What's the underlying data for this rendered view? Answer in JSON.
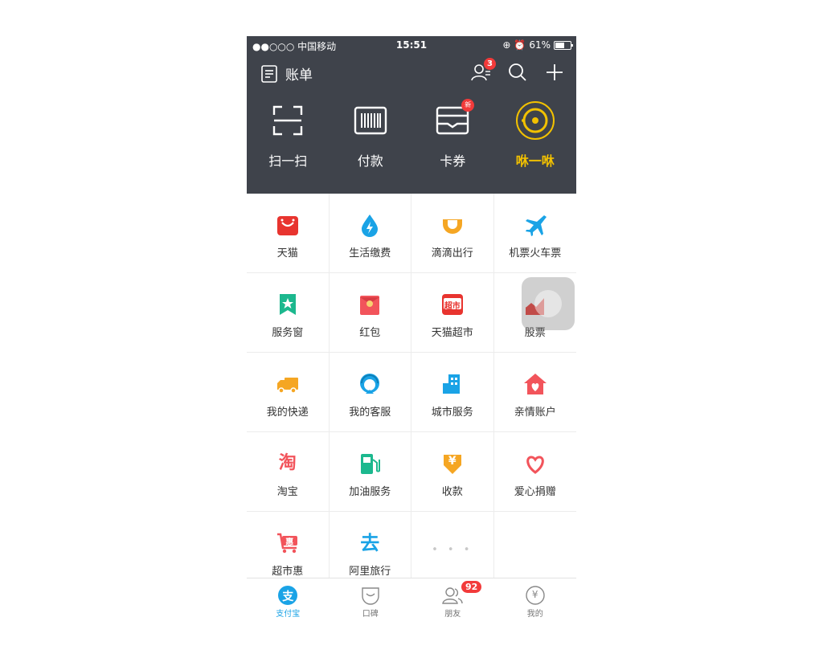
{
  "status_bar": {
    "carrier": "●●○○○ 中国移动",
    "time": "15:51",
    "battery": "61%"
  },
  "header": {
    "bill_label": "账单",
    "contacts_badge": "3"
  },
  "quick_actions": [
    {
      "label": "扫一扫",
      "icon": "scan-icon"
    },
    {
      "label": "付款",
      "icon": "barcode-icon"
    },
    {
      "label": "卡券",
      "icon": "card-voucher-icon",
      "badge": "新"
    },
    {
      "label": "咻一咻",
      "icon": "xiu-icon"
    }
  ],
  "grid": [
    {
      "label": "天猫",
      "icon": "tmall-icon",
      "color": "#e8342f"
    },
    {
      "label": "生活缴费",
      "icon": "water-drop-icon",
      "color": "#1aa3e6"
    },
    {
      "label": "滴滴出行",
      "icon": "didi-icon",
      "color": "#f5a623"
    },
    {
      "label": "机票火车票",
      "icon": "airplane-icon",
      "color": "#1aa3e6"
    },
    {
      "label": "服务窗",
      "icon": "star-bookmark-icon",
      "color": "#1cb88e"
    },
    {
      "label": "红包",
      "icon": "red-envelope-icon",
      "color": "#f2545b"
    },
    {
      "label": "天猫超市",
      "icon": "supermarket-icon",
      "color": "#e8342f",
      "icon_text": "超市"
    },
    {
      "label": "股票",
      "icon": "stock-chart-icon",
      "color": "#e8342f"
    },
    {
      "label": "我的快递",
      "icon": "delivery-truck-icon",
      "color": "#f5a623"
    },
    {
      "label": "我的客服",
      "icon": "customer-service-icon",
      "color": "#1aa3e6"
    },
    {
      "label": "城市服务",
      "icon": "city-building-icon",
      "color": "#1aa3e6"
    },
    {
      "label": "亲情账户",
      "icon": "family-house-icon",
      "color": "#f2545b"
    },
    {
      "label": "淘宝",
      "icon": "taobao-icon",
      "color": "#f2545b",
      "icon_text": "淘"
    },
    {
      "label": "加油服务",
      "icon": "fuel-pump-icon",
      "color": "#1cb88e"
    },
    {
      "label": "收款",
      "icon": "receive-money-icon",
      "color": "#f5a623",
      "icon_text": "¥"
    },
    {
      "label": "爱心捐赠",
      "icon": "heart-charity-icon",
      "color": "#f2545b"
    },
    {
      "label": "超市惠",
      "icon": "shopping-cart-icon",
      "color": "#f2545b",
      "icon_text": "惠"
    },
    {
      "label": "阿里旅行",
      "icon": "ali-travel-icon",
      "color": "#1aa3e6",
      "icon_text": "去"
    }
  ],
  "more_dots": "• • •",
  "tabbar": [
    {
      "label": "支付宝",
      "icon": "alipay-icon",
      "active": true,
      "icon_text": "支"
    },
    {
      "label": "口碑",
      "icon": "koubei-icon",
      "active": false
    },
    {
      "label": "朋友",
      "icon": "friends-icon",
      "active": false,
      "badge": "92"
    },
    {
      "label": "我的",
      "icon": "wallet-yuan-icon",
      "active": false,
      "icon_text": "¥"
    }
  ]
}
